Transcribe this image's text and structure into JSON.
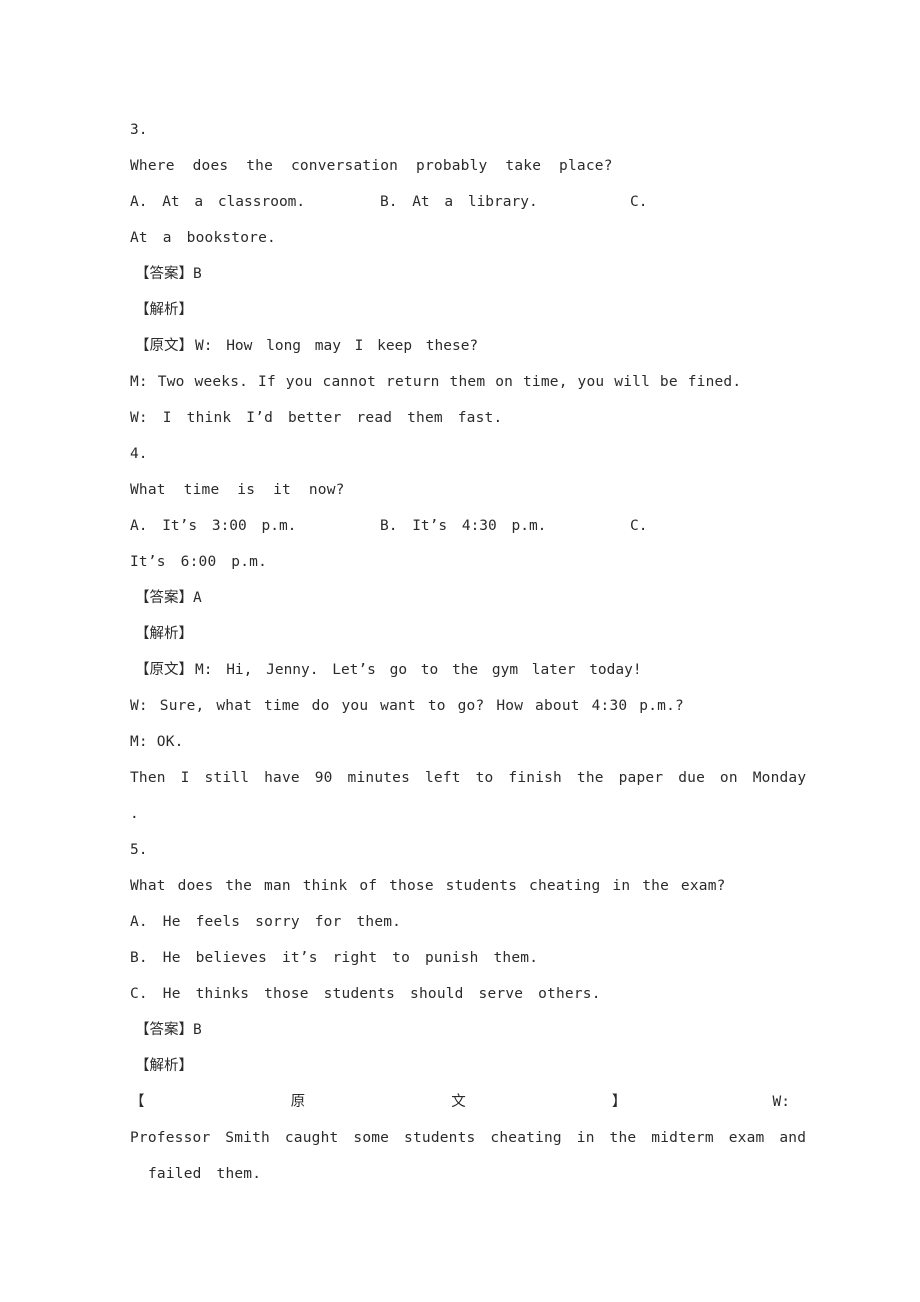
{
  "document": {
    "type": "english-listening-exam-answer-key",
    "page_background": "#ffffff",
    "text_color": "#2b2b2b"
  },
  "labels": {
    "answer": "【答案】",
    "analysis": "【解析】",
    "transcript": "【原文】",
    "bracket_open": "【",
    "bracket_close": "】",
    "yuan": "原",
    "wen": "文"
  },
  "questions": [
    {
      "number": "3.",
      "stem": "Where does the conversation probably take place?",
      "option_a": "A. At a classroom.",
      "option_b": "B. At a library.",
      "option_c_marker": "C.",
      "option_c_wrap": "At a bookstore.",
      "answer_label": "【答案】",
      "answer_value": "B",
      "analysis_label": "【解析】",
      "transcript_label": "【原文】",
      "transcript_lines": [
        "W: How long may I keep these?",
        "M: Two weeks. If you cannot return them on time, you will be fined.",
        "W: I think I’d better read them fast."
      ]
    },
    {
      "number": "4.",
      "stem": "What time is it now?",
      "option_a": "A. It’s 3:00 p.m.",
      "option_b": "B. It’s 4:30 p.m.",
      "option_c_marker": "C.",
      "option_c_wrap": "It’s 6:00 p.m.",
      "answer_label": "【答案】",
      "answer_value": "A",
      "analysis_label": "【解析】",
      "transcript_label": "【原文】",
      "transcript_lines": [
        "M: Hi, Jenny. Let’s go to the gym later today!",
        "W: Sure, what time do you want to go? How about 4:30 p.m.?",
        "M: OK.",
        "Then I still have 90 minutes left to finish the paper due on Monday",
        "."
      ]
    },
    {
      "number": "5.",
      "stem": "What does the man think of those students cheating in the exam?",
      "option_a": "A. He feels sorry for them.",
      "option_b": "B. He believes it’s right to punish them.",
      "option_c": "C. He thinks those students should serve others.",
      "answer_label": "【答案】",
      "answer_value": "B",
      "analysis_label": "【解析】",
      "transcript_speaker": "W:",
      "transcript_lines": [
        "Professor Smith caught some students cheating in the midterm exam and",
        "failed them."
      ]
    }
  ]
}
